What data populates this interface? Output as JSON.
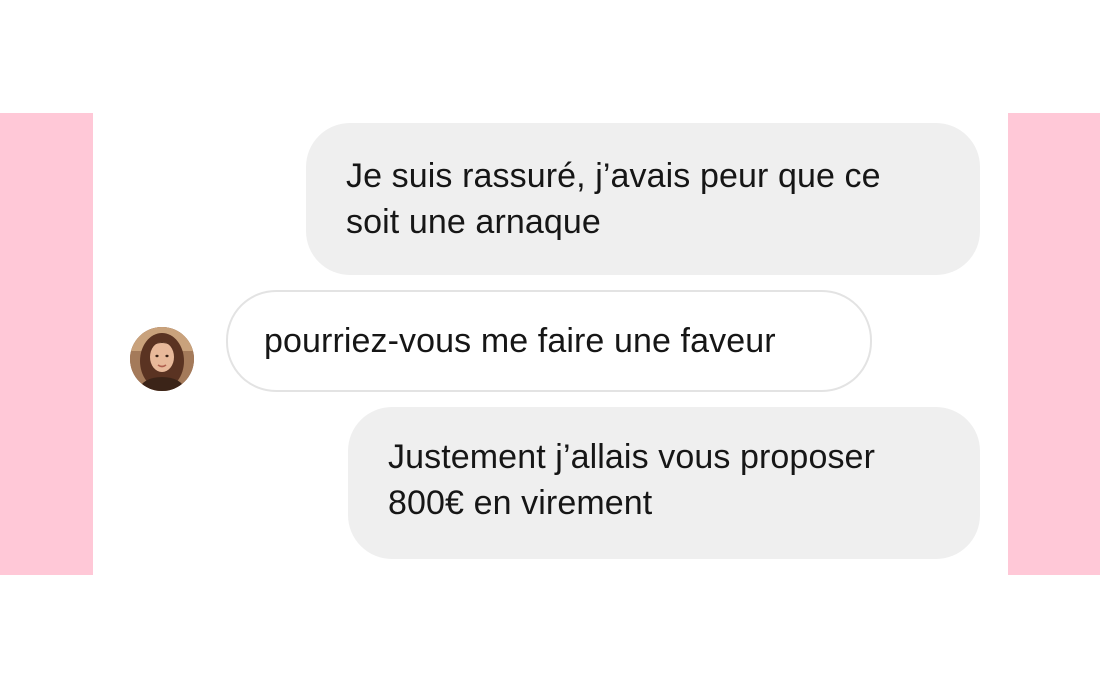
{
  "messages": [
    {
      "direction": "sent",
      "lines": [
        "Je suis rassuré, j’avais peur que ce",
        "soit une arnaque"
      ]
    },
    {
      "direction": "received",
      "lines": [
        "pourriez-vous me faire une faveur"
      ],
      "avatar_icon": "contact-avatar"
    },
    {
      "direction": "sent",
      "lines": [
        "Justement j’allais vous proposer",
        "800€ en virement"
      ]
    }
  ],
  "colors": {
    "side_bars": "#ffc8d7",
    "sent_bubble": "#efefef",
    "received_bubble_border": "#e3e3e3",
    "text": "#161616"
  }
}
